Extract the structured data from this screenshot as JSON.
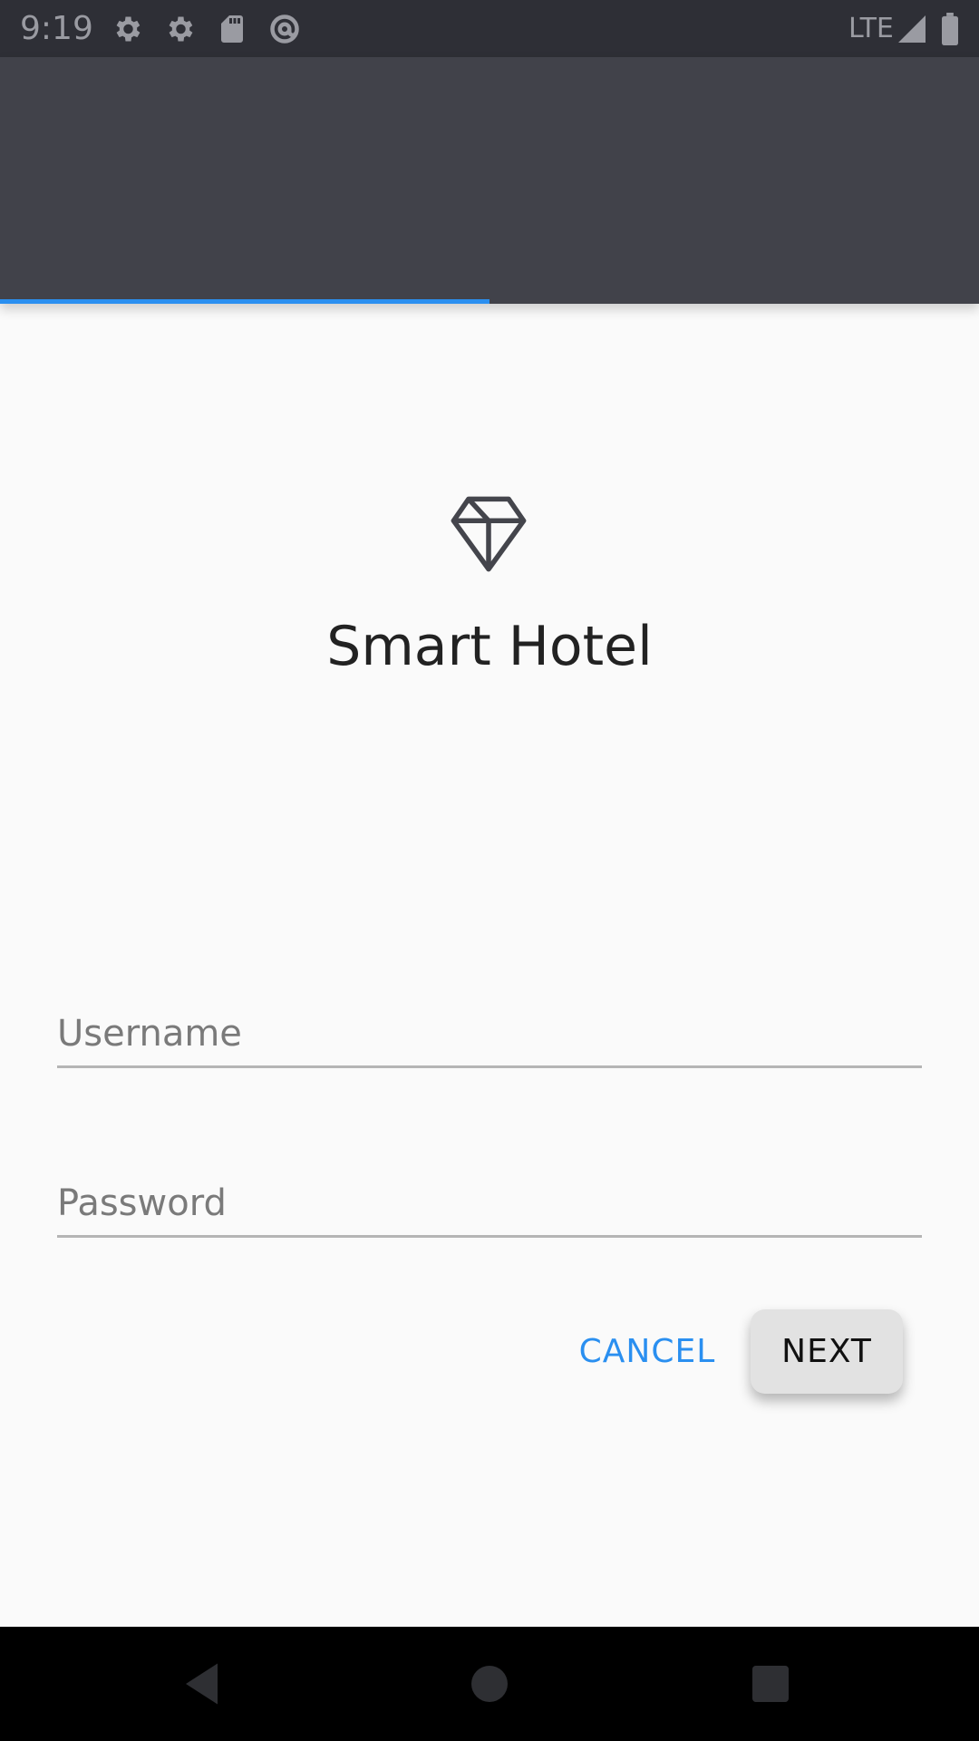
{
  "status_bar": {
    "time": "9:19",
    "network": "LTE",
    "icons": [
      "settings-icon",
      "settings-icon",
      "sd-card-icon",
      "at-sign-icon",
      "signal-icon",
      "battery-icon"
    ]
  },
  "progress": {
    "value": 0.5,
    "color": "#2a8ff0"
  },
  "brand": {
    "name": "Smart Hotel",
    "logo_icon": "diamond-icon"
  },
  "form": {
    "username": {
      "placeholder": "Username",
      "value": ""
    },
    "password": {
      "placeholder": "Password",
      "value": ""
    },
    "cancel_label": "CANCEL",
    "next_label": "NEXT"
  },
  "nav_bar": {
    "icons": [
      "back-icon",
      "home-icon",
      "recents-icon"
    ]
  },
  "colors": {
    "accent": "#2a8ff0",
    "appbar": "#41424a",
    "statusbar": "#2e2f36"
  }
}
